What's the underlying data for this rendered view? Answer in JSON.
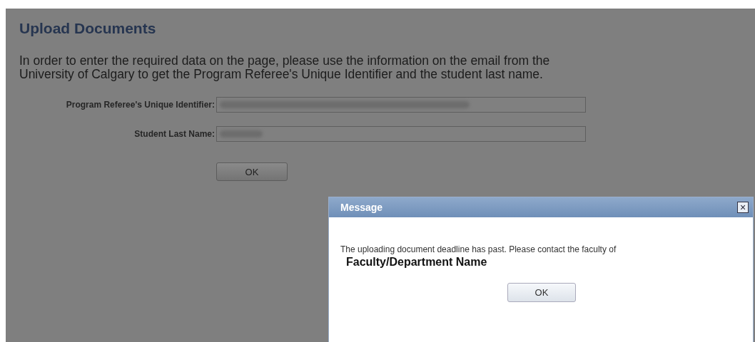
{
  "page": {
    "title": "Upload Documents",
    "instructions": "In order to enter the required data on the page, please use the information on the email from the University of Calgary to get the Program Referee's Unique Identifier and the student last name."
  },
  "fields": [
    {
      "label": "Program Referee's Unique Identifier:",
      "redacted": true
    },
    {
      "label": "Student Last Name:",
      "redacted": true
    }
  ],
  "ok_button": "OK",
  "dialog": {
    "title": "Message",
    "close": "×",
    "message": "The uploading document deadline has past. Please contact  the faculty of **Faculty/Department Name**",
    "button": "OK"
  }
}
